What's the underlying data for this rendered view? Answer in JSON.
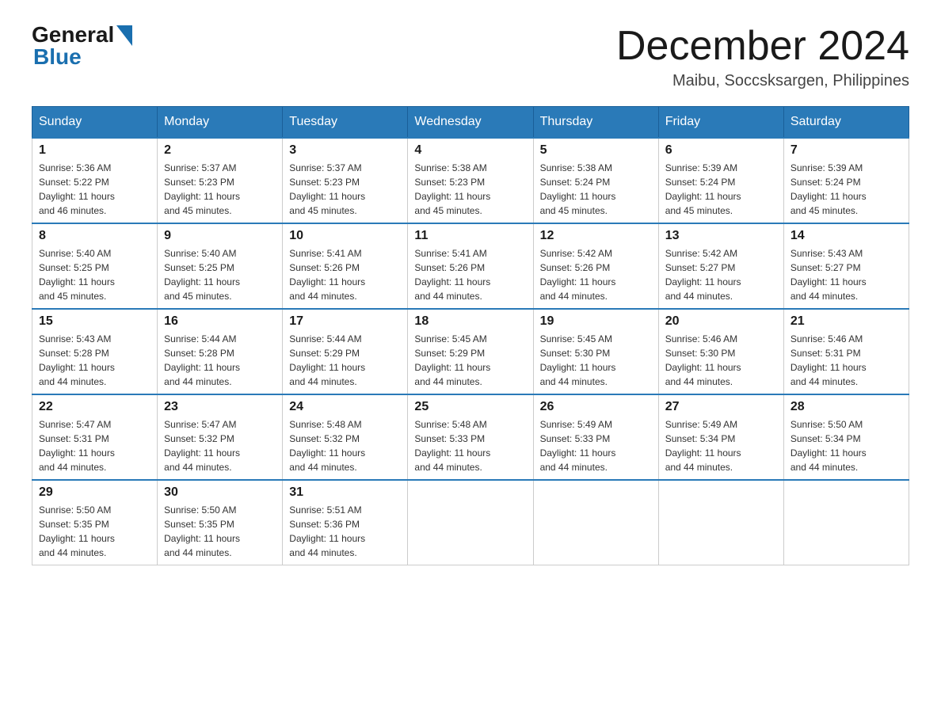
{
  "header": {
    "logo": {
      "text_general": "General",
      "text_blue": "Blue",
      "aria": "GeneralBlue logo"
    },
    "title": "December 2024",
    "subtitle": "Maibu, Soccsksargen, Philippines"
  },
  "calendar": {
    "days_of_week": [
      "Sunday",
      "Monday",
      "Tuesday",
      "Wednesday",
      "Thursday",
      "Friday",
      "Saturday"
    ],
    "weeks": [
      [
        {
          "day": "1",
          "sunrise": "5:36 AM",
          "sunset": "5:22 PM",
          "daylight": "11 hours and 46 minutes."
        },
        {
          "day": "2",
          "sunrise": "5:37 AM",
          "sunset": "5:23 PM",
          "daylight": "11 hours and 45 minutes."
        },
        {
          "day": "3",
          "sunrise": "5:37 AM",
          "sunset": "5:23 PM",
          "daylight": "11 hours and 45 minutes."
        },
        {
          "day": "4",
          "sunrise": "5:38 AM",
          "sunset": "5:23 PM",
          "daylight": "11 hours and 45 minutes."
        },
        {
          "day": "5",
          "sunrise": "5:38 AM",
          "sunset": "5:24 PM",
          "daylight": "11 hours and 45 minutes."
        },
        {
          "day": "6",
          "sunrise": "5:39 AM",
          "sunset": "5:24 PM",
          "daylight": "11 hours and 45 minutes."
        },
        {
          "day": "7",
          "sunrise": "5:39 AM",
          "sunset": "5:24 PM",
          "daylight": "11 hours and 45 minutes."
        }
      ],
      [
        {
          "day": "8",
          "sunrise": "5:40 AM",
          "sunset": "5:25 PM",
          "daylight": "11 hours and 45 minutes."
        },
        {
          "day": "9",
          "sunrise": "5:40 AM",
          "sunset": "5:25 PM",
          "daylight": "11 hours and 45 minutes."
        },
        {
          "day": "10",
          "sunrise": "5:41 AM",
          "sunset": "5:26 PM",
          "daylight": "11 hours and 44 minutes."
        },
        {
          "day": "11",
          "sunrise": "5:41 AM",
          "sunset": "5:26 PM",
          "daylight": "11 hours and 44 minutes."
        },
        {
          "day": "12",
          "sunrise": "5:42 AM",
          "sunset": "5:26 PM",
          "daylight": "11 hours and 44 minutes."
        },
        {
          "day": "13",
          "sunrise": "5:42 AM",
          "sunset": "5:27 PM",
          "daylight": "11 hours and 44 minutes."
        },
        {
          "day": "14",
          "sunrise": "5:43 AM",
          "sunset": "5:27 PM",
          "daylight": "11 hours and 44 minutes."
        }
      ],
      [
        {
          "day": "15",
          "sunrise": "5:43 AM",
          "sunset": "5:28 PM",
          "daylight": "11 hours and 44 minutes."
        },
        {
          "day": "16",
          "sunrise": "5:44 AM",
          "sunset": "5:28 PM",
          "daylight": "11 hours and 44 minutes."
        },
        {
          "day": "17",
          "sunrise": "5:44 AM",
          "sunset": "5:29 PM",
          "daylight": "11 hours and 44 minutes."
        },
        {
          "day": "18",
          "sunrise": "5:45 AM",
          "sunset": "5:29 PM",
          "daylight": "11 hours and 44 minutes."
        },
        {
          "day": "19",
          "sunrise": "5:45 AM",
          "sunset": "5:30 PM",
          "daylight": "11 hours and 44 minutes."
        },
        {
          "day": "20",
          "sunrise": "5:46 AM",
          "sunset": "5:30 PM",
          "daylight": "11 hours and 44 minutes."
        },
        {
          "day": "21",
          "sunrise": "5:46 AM",
          "sunset": "5:31 PM",
          "daylight": "11 hours and 44 minutes."
        }
      ],
      [
        {
          "day": "22",
          "sunrise": "5:47 AM",
          "sunset": "5:31 PM",
          "daylight": "11 hours and 44 minutes."
        },
        {
          "day": "23",
          "sunrise": "5:47 AM",
          "sunset": "5:32 PM",
          "daylight": "11 hours and 44 minutes."
        },
        {
          "day": "24",
          "sunrise": "5:48 AM",
          "sunset": "5:32 PM",
          "daylight": "11 hours and 44 minutes."
        },
        {
          "day": "25",
          "sunrise": "5:48 AM",
          "sunset": "5:33 PM",
          "daylight": "11 hours and 44 minutes."
        },
        {
          "day": "26",
          "sunrise": "5:49 AM",
          "sunset": "5:33 PM",
          "daylight": "11 hours and 44 minutes."
        },
        {
          "day": "27",
          "sunrise": "5:49 AM",
          "sunset": "5:34 PM",
          "daylight": "11 hours and 44 minutes."
        },
        {
          "day": "28",
          "sunrise": "5:50 AM",
          "sunset": "5:34 PM",
          "daylight": "11 hours and 44 minutes."
        }
      ],
      [
        {
          "day": "29",
          "sunrise": "5:50 AM",
          "sunset": "5:35 PM",
          "daylight": "11 hours and 44 minutes."
        },
        {
          "day": "30",
          "sunrise": "5:50 AM",
          "sunset": "5:35 PM",
          "daylight": "11 hours and 44 minutes."
        },
        {
          "day": "31",
          "sunrise": "5:51 AM",
          "sunset": "5:36 PM",
          "daylight": "11 hours and 44 minutes."
        },
        null,
        null,
        null,
        null
      ]
    ]
  }
}
